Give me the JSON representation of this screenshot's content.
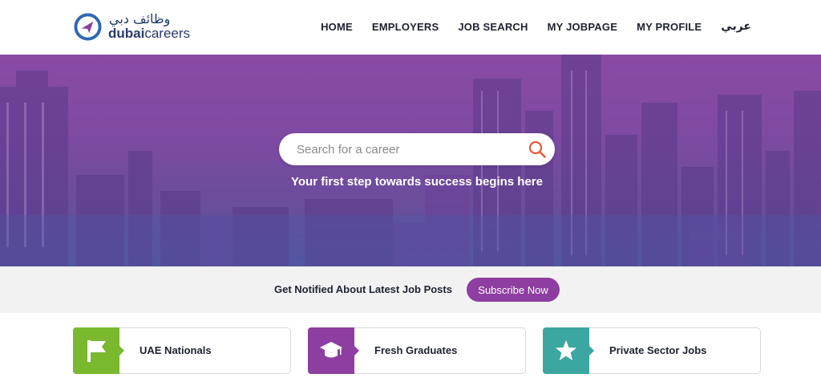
{
  "header": {
    "logo_arabic": "وظائف دبي",
    "logo_bold": "dubai",
    "logo_light": "careers",
    "nav": [
      "HOME",
      "EMPLOYERS",
      "JOB SEARCH",
      "MY JOBPAGE",
      "MY PROFILE",
      "عربي"
    ]
  },
  "hero": {
    "search_placeholder": "Search for a career",
    "tagline": "Your first step towards success begins here"
  },
  "subscribe": {
    "text": "Get Notified About Latest Job Posts",
    "button": "Subscribe Now"
  },
  "categories": [
    {
      "label": "UAE Nationals",
      "icon": "flag-icon",
      "color": "#7ab82e"
    },
    {
      "label": "Fresh Graduates",
      "icon": "graduation-cap-icon",
      "color": "#8e3ea0"
    },
    {
      "label": "Private Sector Jobs",
      "icon": "star-icon",
      "color": "#3ba7a0"
    }
  ],
  "colors": {
    "brand_purple": "#8e3ea0",
    "hero_gradient_top": "#8a4aa6",
    "hero_gradient_bottom": "#55559e",
    "search_icon": "#e45a3a"
  }
}
